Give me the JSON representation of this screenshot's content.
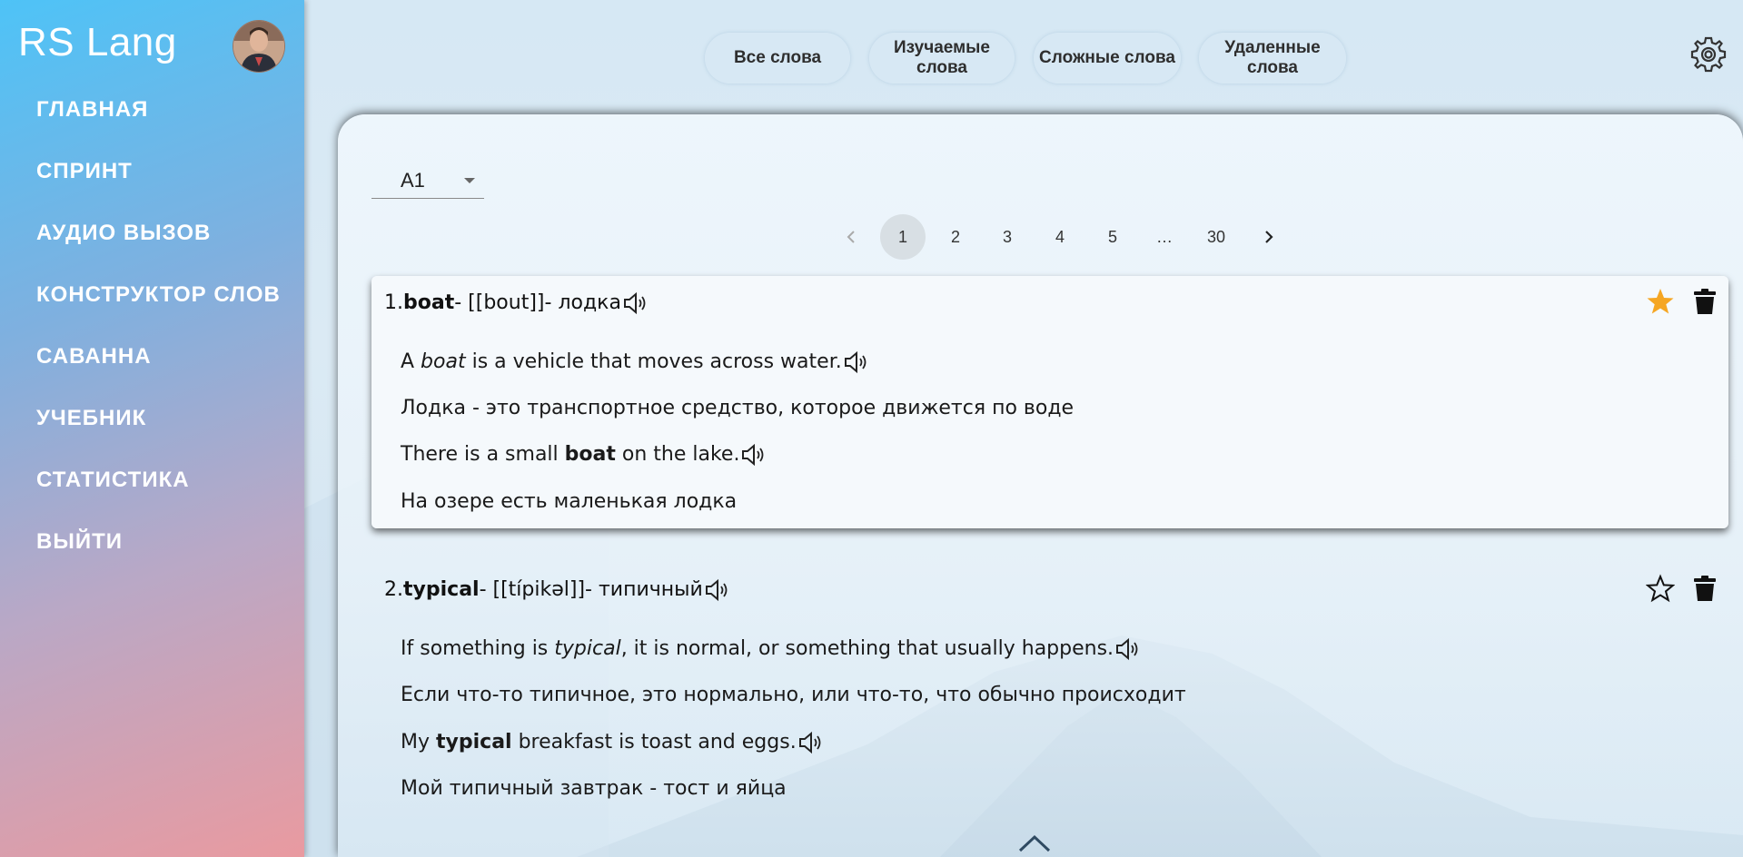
{
  "app": {
    "title": "RS Lang"
  },
  "sidebar": {
    "items": [
      {
        "label": "ГЛАВНАЯ"
      },
      {
        "label": "СПРИНТ"
      },
      {
        "label": "АУДИО ВЫЗОВ"
      },
      {
        "label": "КОНСТРУКТОР СЛОВ"
      },
      {
        "label": "САВАННА"
      },
      {
        "label": "УЧЕБНИК"
      },
      {
        "label": "СТАТИСТИКА"
      },
      {
        "label": "ВЫЙТИ"
      }
    ]
  },
  "tabs": [
    {
      "label": "Все слова"
    },
    {
      "label": "Изучаемые слова"
    },
    {
      "label": "Сложные слова"
    },
    {
      "label": "Удаленные слова"
    }
  ],
  "level": {
    "selected": "A1"
  },
  "pagination": {
    "pages": [
      "1",
      "2",
      "3",
      "4",
      "5",
      "…",
      "30"
    ],
    "current": "1"
  },
  "words": [
    {
      "number": "1.",
      "word": "boat",
      "transcription": "- [[bout]]- ",
      "translation": "лодка",
      "meaning_pre": "A ",
      "meaning_word": "boat",
      "meaning_post": " is a vehicle that moves across water.",
      "meaning_translation": "Лодка - это транспортное средство, которое движется по воде",
      "example_pre": "There is a small ",
      "example_word": "boat",
      "example_post": " on the lake.",
      "example_translation": "На озере есть маленькая лодка",
      "difficult": true,
      "star_color": "#f5a623"
    },
    {
      "number": "2.",
      "word": "typical",
      "transcription": "- [[típikəl]]- ",
      "translation": "типичный",
      "meaning_pre": "If something is ",
      "meaning_word": "typical",
      "meaning_post": ", it is normal, or something that usually happens.",
      "meaning_translation": "Если что-то типичное, это нормально, или что-то, что обычно происходит",
      "example_pre": "My ",
      "example_word": "typical",
      "example_post": " breakfast is toast and eggs.",
      "example_translation": "Мой типичный завтрак - тост и яйца",
      "difficult": false
    }
  ]
}
